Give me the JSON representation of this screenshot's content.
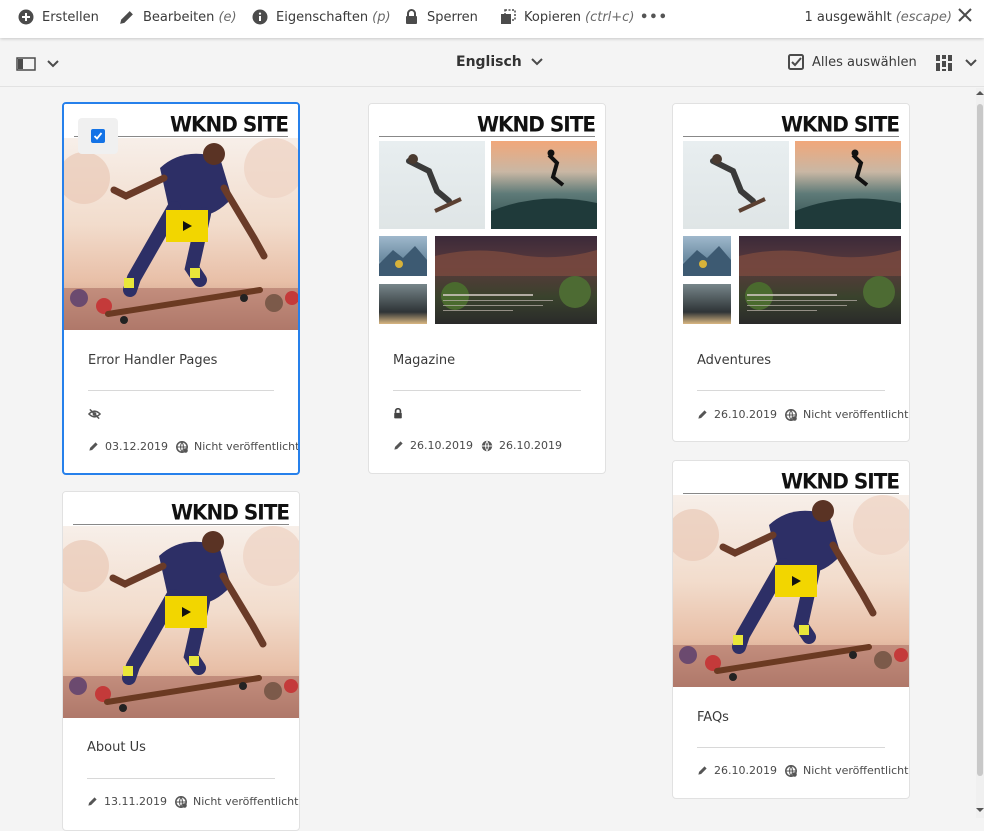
{
  "actionbar": {
    "create": "Erstellen",
    "edit": "Bearbeiten",
    "edit_short": "(e)",
    "properties": "Eigenschaften",
    "properties_short": "(p)",
    "lock": "Sperren",
    "copy": "Kopieren",
    "copy_short": "(ctrl+c)",
    "more": "•••",
    "selected": "1 ausgewählt",
    "selected_short": "(escape)"
  },
  "subbar": {
    "language": "Englisch",
    "select_all": "Alles auswählen"
  },
  "brand": "WKND SITE",
  "cards": [
    {
      "title": "Error Handler Pages",
      "hidden_icon": "eye-off-icon",
      "modified": "03.12.2019",
      "status": "Nicht veröffentlicht",
      "selected": true
    },
    {
      "title": "Magazine",
      "lock_icon": "lock-icon",
      "modified": "26.10.2019",
      "published": "26.10.2019"
    },
    {
      "title": "Adventures",
      "modified": "26.10.2019",
      "status": "Nicht veröffentlicht"
    },
    {
      "title": "About Us",
      "modified": "13.11.2019",
      "status": "Nicht veröffentlicht"
    },
    {
      "title": "FAQs",
      "modified": "26.10.2019",
      "status": "Nicht veröffentlicht"
    }
  ],
  "colors": {
    "accent": "#2680eb",
    "play": "#f2d600"
  }
}
